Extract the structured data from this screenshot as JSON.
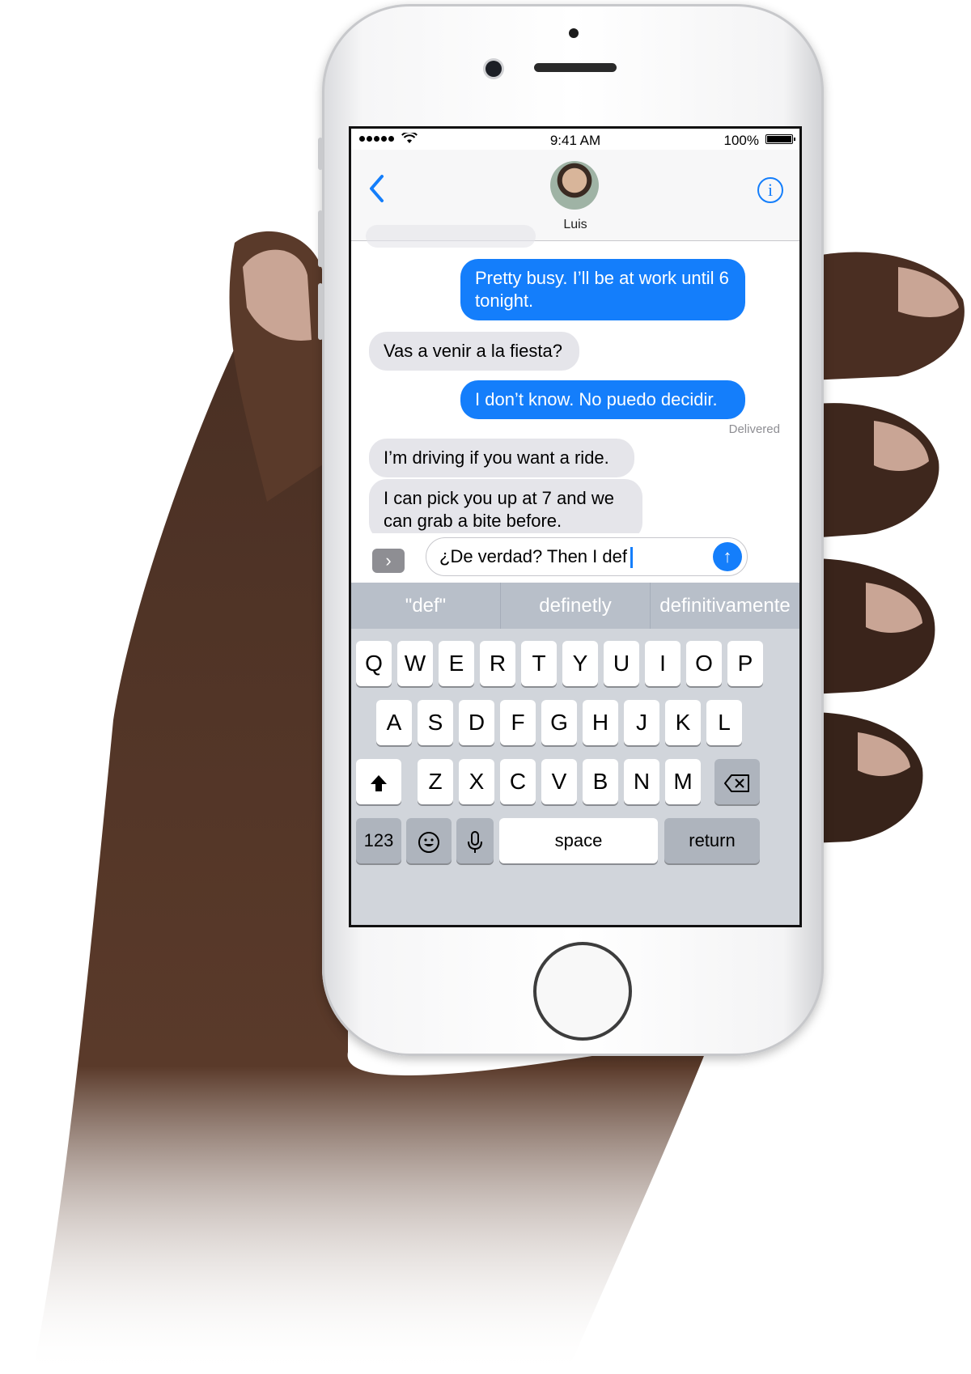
{
  "status_bar": {
    "time": "9:41 AM",
    "battery": "100%"
  },
  "contact": {
    "name": "Luis"
  },
  "messages": [
    {
      "direction": "out",
      "text": "Pretty busy. I’ll be at work until 6 tonight."
    },
    {
      "direction": "in",
      "text": "Vas a venir a la fiesta?"
    },
    {
      "direction": "out",
      "text": "I don’t know. No puedo decidir."
    },
    {
      "direction": "in",
      "text": "I’m driving if you want a ride."
    },
    {
      "direction": "in",
      "text": "I can pick you up at 7 and we can grab a bite before."
    }
  ],
  "delivered_label": "Delivered",
  "compose": {
    "value": "¿De verdad? Then I def"
  },
  "suggestions": [
    "\"def\"",
    "definetly",
    "definitivamente"
  ],
  "keyboard": {
    "row1": [
      "Q",
      "W",
      "E",
      "R",
      "T",
      "Y",
      "U",
      "I",
      "O",
      "P"
    ],
    "row2": [
      "A",
      "S",
      "D",
      "F",
      "G",
      "H",
      "J",
      "K",
      "L"
    ],
    "row3": [
      "Z",
      "X",
      "C",
      "V",
      "B",
      "N",
      "M"
    ],
    "numbers_label": "123",
    "space_label": "space",
    "return_label": "return"
  },
  "colors": {
    "accent": "#147efb",
    "incoming_bubble": "#e5e5ea"
  }
}
